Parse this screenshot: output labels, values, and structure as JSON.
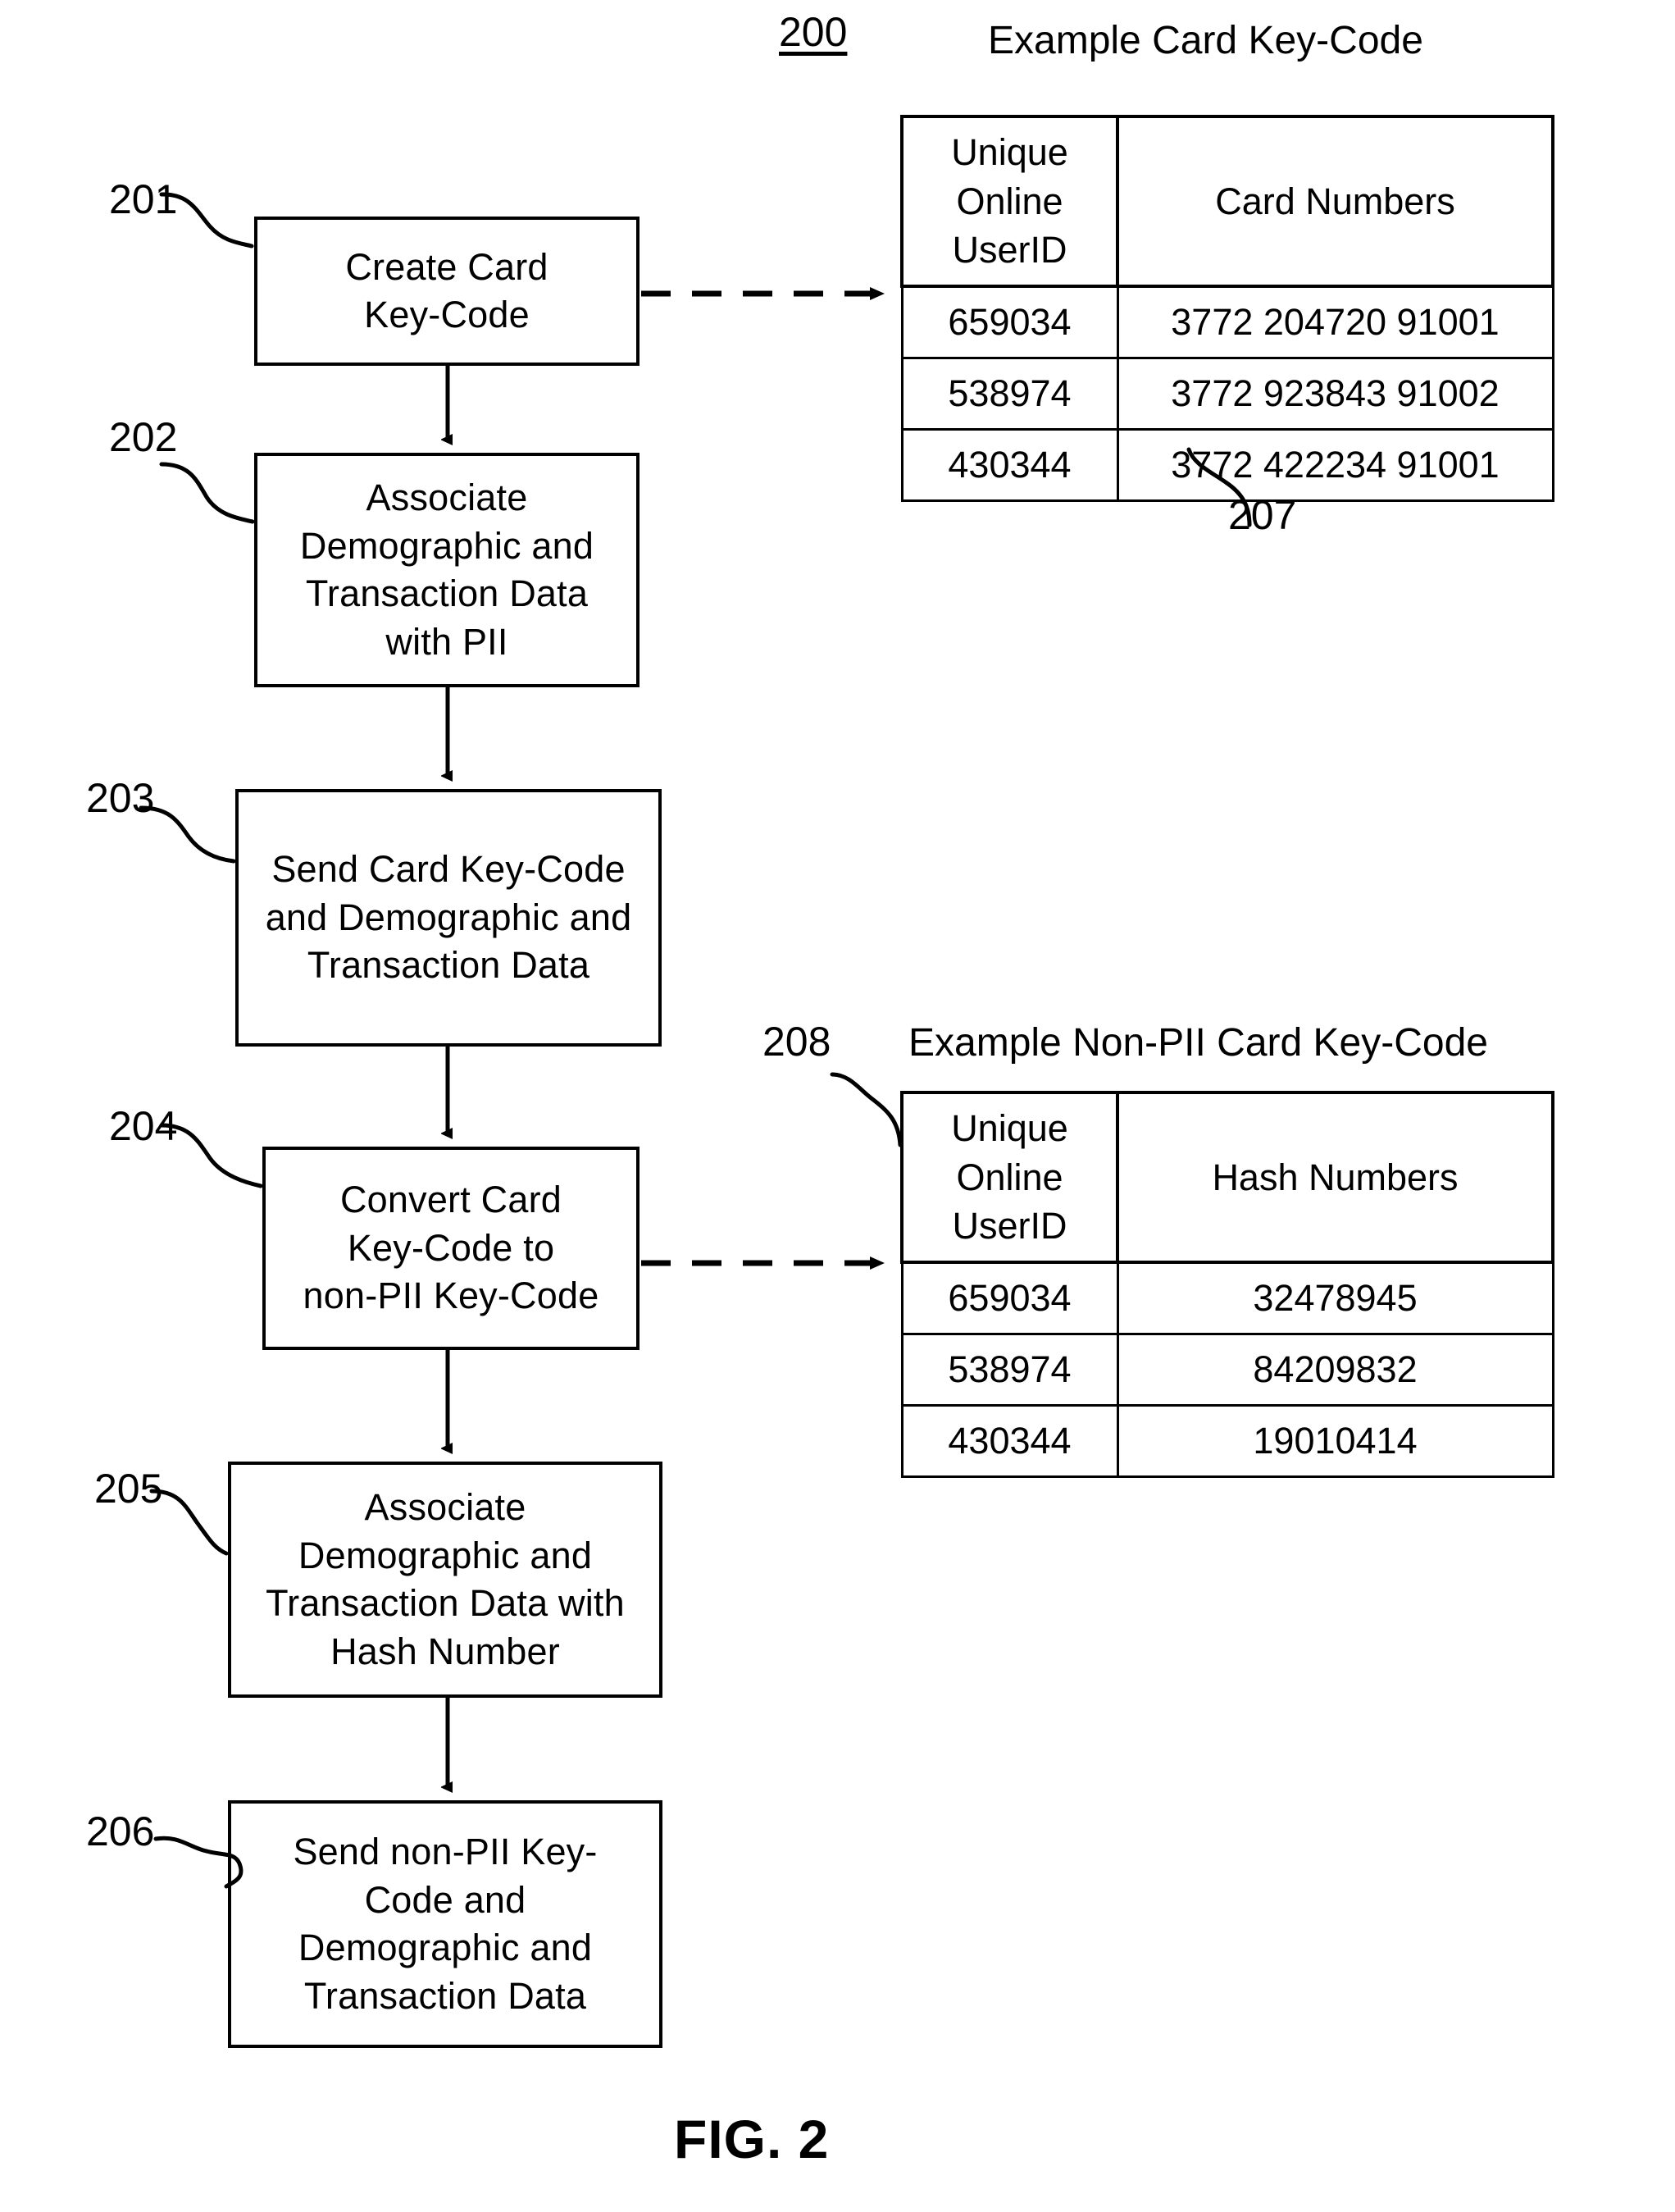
{
  "figure": {
    "caption": "FIG. 2",
    "diagram_ref": "200"
  },
  "flowchart": {
    "steps": [
      {
        "ref": "201",
        "lines": [
          "Create Card",
          "Key-Code"
        ],
        "text": "Create Card Key-Code"
      },
      {
        "ref": "202",
        "lines": [
          "Associate",
          "Demographic and",
          "Transaction Data",
          "with PII"
        ],
        "text": "Associate Demographic and Transaction Data with PII"
      },
      {
        "ref": "203",
        "lines": [
          "Send Card Key-Code",
          "and Demographic and",
          "Transaction Data"
        ],
        "text": "Send Card Key-Code and Demographic and Transaction Data"
      },
      {
        "ref": "204",
        "lines": [
          "Convert Card",
          "Key-Code to",
          "non-PII Key-Code"
        ],
        "text": "Convert Card Key-Code to non-PII Key-Code"
      },
      {
        "ref": "205",
        "lines": [
          "Associate",
          "Demographic and",
          "Transaction Data with",
          "Hash Number"
        ],
        "text": "Associate Demographic and Transaction Data with Hash Number"
      },
      {
        "ref": "206",
        "lines": [
          "Send non-PII Key-",
          "Code and",
          "Demographic and",
          "Transaction Data"
        ],
        "text": "Send non-PII Key-Code and Demographic and Transaction Data"
      }
    ]
  },
  "tables": [
    {
      "ref": "207",
      "title": "Example Card Key-Code",
      "columns": [
        "Unique Online UserID",
        "Card Numbers"
      ],
      "column_lines": [
        [
          "Unique",
          "Online",
          "UserID"
        ],
        [
          "Card Numbers"
        ]
      ],
      "rows": [
        [
          "659034",
          "3772 204720 91001"
        ],
        [
          "538974",
          "3772 923843 91002"
        ],
        [
          "430344",
          "3772 422234 91001"
        ]
      ]
    },
    {
      "ref": "208",
      "title": "Example Non-PII Card Key-Code",
      "columns": [
        "Unique Online UserID",
        "Hash Numbers"
      ],
      "column_lines": [
        [
          "Unique",
          "Online",
          "UserID"
        ],
        [
          "Hash Numbers"
        ]
      ],
      "rows": [
        [
          "659034",
          "32478945"
        ],
        [
          "538974",
          "84209832"
        ],
        [
          "430344",
          "19010414"
        ]
      ]
    }
  ],
  "colors": {
    "ink": "#000000",
    "paper": "#ffffff"
  }
}
